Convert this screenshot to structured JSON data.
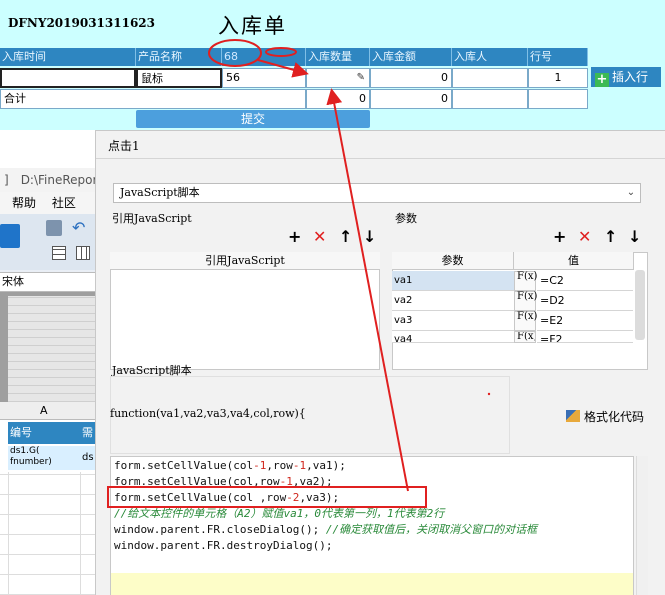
{
  "report": {
    "doc_no": "DFNY2019031311623",
    "title": "入库单",
    "headers": [
      "入库时间",
      "产品名称",
      "68",
      "入库数量",
      "入库金额",
      "入库人",
      "行号"
    ],
    "row": {
      "product": "鼠标",
      "code": "56",
      "amount": "0",
      "row_no": "1"
    },
    "total": {
      "label": "合计",
      "qty": "0",
      "amount": "0"
    },
    "insert_label": "插入行",
    "submit_label": "提交"
  },
  "designer": {
    "title": "D:\\FineRepor",
    "menu": [
      "帮助",
      "社区"
    ],
    "font": "宋体",
    "col_header": "A",
    "cells": [
      "编号",
      "需",
      "ds1.G(\nfnumber)",
      "ds"
    ]
  },
  "dialog": {
    "title": "点击1",
    "type_value": "JavaScript脚本",
    "ref_label": "引用JavaScript",
    "ref_header": "引用JavaScript",
    "params_label": "参数",
    "params_headers": [
      "参数",
      "值"
    ],
    "params": [
      {
        "name": "va1",
        "value": "=C2"
      },
      {
        "name": "va2",
        "value": "=D2"
      },
      {
        "name": "va3",
        "value": "=E2"
      },
      {
        "name": "va4",
        "value": "=F2"
      }
    ],
    "script_label": "JavaScript脚本",
    "fn_signature": "function(va1,va2,va3,va4,col,row){",
    "format_label": "格式化代码",
    "fx_label": "F(x)"
  },
  "code": {
    "line1": {
      "a": "form.setCellValue(col",
      "n1": "-1",
      "b": ",row",
      "n2": "-1",
      "c": ",va1);"
    },
    "line2": {
      "a": "form.setCellValue(col,row",
      "n2": "-1",
      "c": ",va2);"
    },
    "line3": {
      "a": "form.setCellValue(col ,row",
      "n2": "-2",
      "c": ",va3);"
    },
    "line4": "//给文本控件的单元格（A2）赋值va1，0代表第一列，1代表第2行",
    "line5": {
      "a": "window.parent.FR.closeDialog(); ",
      "c": "//确定获取值后，关闭取消父窗口的对话框"
    },
    "line6": "window.parent.FR.destroyDialog();"
  },
  "colors": {
    "report_bg": "#ccffff",
    "header_bg": "#2e86c1",
    "dialog_bg": "#f2f2f2",
    "annotation": "#e02020"
  }
}
